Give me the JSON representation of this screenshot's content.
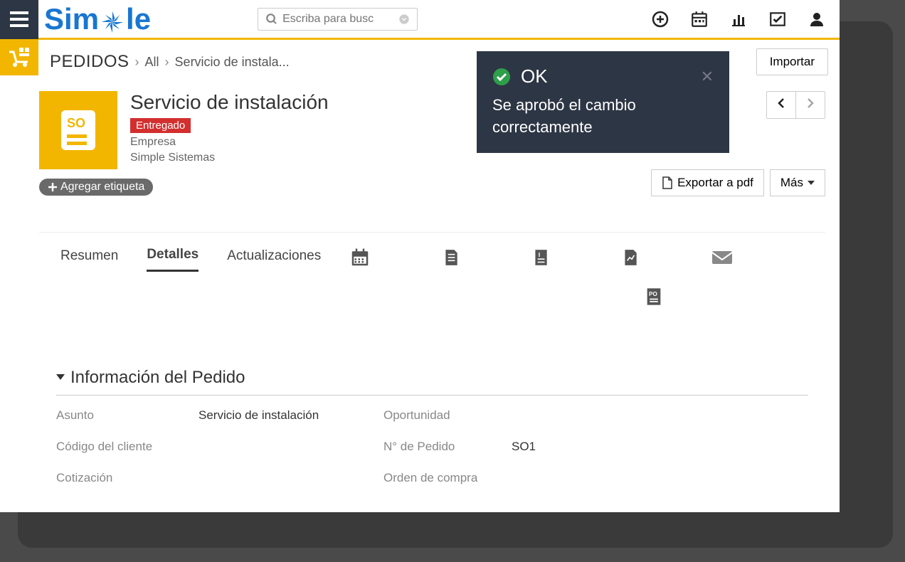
{
  "brand": "Simple",
  "search": {
    "placeholder": "Escriba para busc"
  },
  "breadcrumb": {
    "root": "PEDIDOS",
    "level1": "All",
    "level2": "Servicio de instala..."
  },
  "buttons": {
    "import": "Importar",
    "export_pdf": "Exportar a pdf",
    "more": "Más",
    "add_tag": "Agregar etiqueta"
  },
  "toast": {
    "title": "OK",
    "body": "Se aprobó el cambio correctamente"
  },
  "record": {
    "icon_text": "SO",
    "title": "Servicio de instalación",
    "status": "Entregado",
    "company_label": "Empresa",
    "company": "Simple Sistemas"
  },
  "tabs": {
    "summary": "Resumen",
    "details": "Detalles",
    "updates": "Actualizaciones"
  },
  "section": {
    "title": "Información del Pedido",
    "fields": {
      "asunto_label": "Asunto",
      "asunto_value": "Servicio de instalación",
      "oportunidad_label": "Oportunidad",
      "oportunidad_value": "",
      "codigo_label": "Código del cliente",
      "codigo_value": "",
      "pedido_label": "N° de Pedido",
      "pedido_value": "SO1",
      "cotizacion_label": "Cotización",
      "cotizacion_value": "",
      "orden_label": "Orden de compra",
      "orden_value": ""
    }
  }
}
